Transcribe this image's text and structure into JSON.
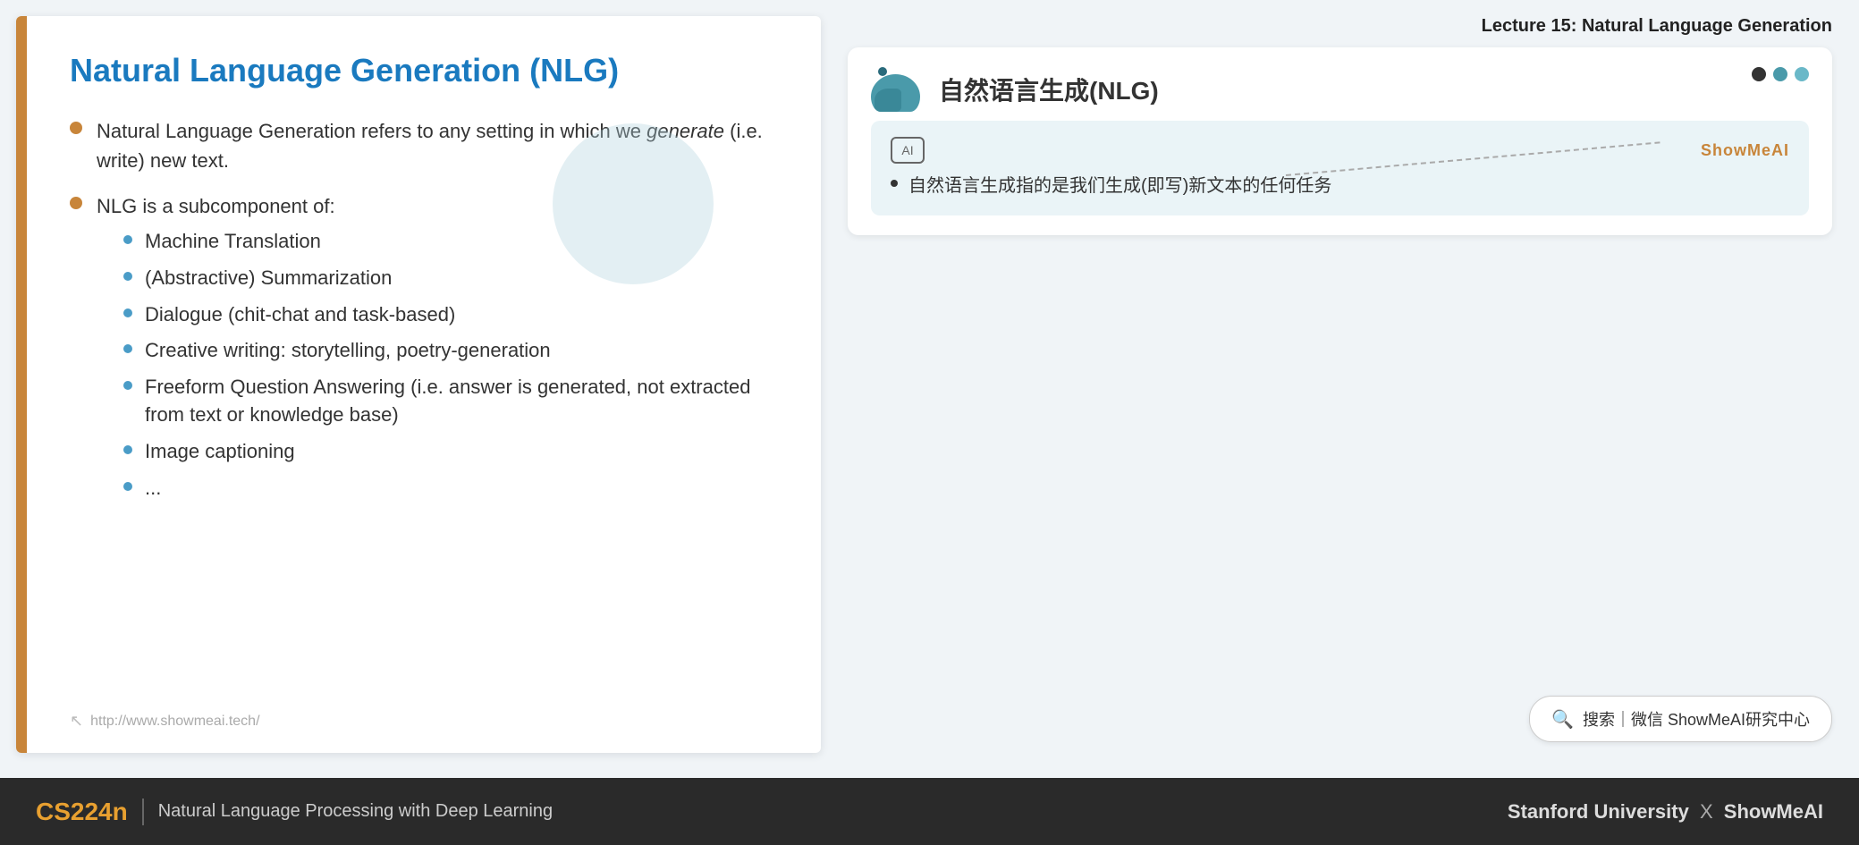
{
  "header": {
    "lecture_title": "Lecture 15: Natural Language Generation"
  },
  "slide": {
    "title": "Natural Language Generation (NLG)",
    "url": "http://www.showmeai.tech/",
    "main_bullets": [
      {
        "text_before": "Natural Language Generation refers to any setting in which we ",
        "text_italic": "generate",
        "text_after": " (i.e. write) new text.",
        "sub_bullets": []
      },
      {
        "text": "NLG is a subcomponent of:",
        "sub_bullets": [
          "Machine Translation",
          "(Abstractive) Summarization",
          "Dialogue (chit-chat and task-based)",
          "Creative writing: storytelling, poetry-generation",
          "Freeform Question Answering (i.e. answer is generated, not extracted from text or knowledge base)",
          "Image captioning",
          "..."
        ]
      }
    ]
  },
  "right_panel": {
    "nlg_chinese_title": "自然语言生成(NLG)",
    "translation_label": "ShowMeAI",
    "translation_bullet": "自然语言生成指的是我们生成(即写)新文本的任何任务",
    "search_text": "搜索｜微信 ShowMeAI研究中心"
  },
  "bottom_bar": {
    "course_code": "CS224n",
    "separator": "|",
    "course_name": "Natural Language Processing with Deep Learning",
    "university": "Stanford University",
    "x_label": "X",
    "brand": "ShowMeAI"
  }
}
